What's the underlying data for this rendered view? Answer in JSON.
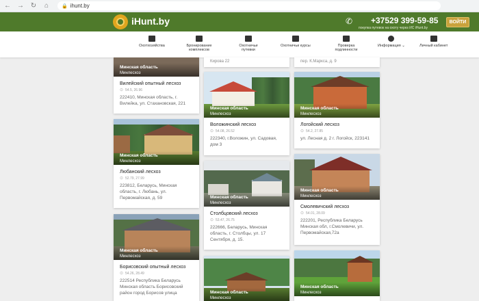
{
  "browser": {
    "url": "ihunt.by"
  },
  "header": {
    "brand": "iHunt.by",
    "phone": "+37529 399-59-85",
    "phone_note": "покупка путевок на охоту через ИС iHunt.by",
    "login": "ВОЙТИ"
  },
  "nav": {
    "items": [
      {
        "label": "Охотхозяйства"
      },
      {
        "label": "Бронирование комплексов"
      },
      {
        "label": "Охотничьи путевки"
      },
      {
        "label": "Охотничьи курсы"
      },
      {
        "label": "Проверка подлинности"
      },
      {
        "label": "Информация ⌄"
      },
      {
        "label": "Личный кабинет"
      }
    ]
  },
  "partial": {
    "col2_address": "Кирова 22",
    "col3_address": "пер. К.Маркса, д. 9"
  },
  "cards": [
    {
      "region": "Минская область",
      "org": "Минлесхоз",
      "title": "Вилейский опытный лесхоз",
      "coords": "54.5, 26.96",
      "address": "222410, Минская область, г. Вилейка, ул. Стахановская, 221"
    },
    {
      "region": "Минская область",
      "org": "Минлесхоз",
      "title": "Любанский лесхоз",
      "coords": "52.79, 27.99",
      "address": "223812, Беларусь, Минская область, г. Любань, ул. Первомайская, д. 59"
    },
    {
      "region": "Минская область",
      "org": "Минлесхоз",
      "title": "Борисовский опытный лесхоз",
      "coords": "54.26, 28.49",
      "address": "222514 Республика Беларусь Минская область Борисовский район город Борисов улица"
    },
    {
      "region": "Минская область",
      "org": "Минлесхоз",
      "title": "Воложинский лесхоз",
      "coords": "54.08, 26.52",
      "address": "222340, г.Воложин, ул. Садовая, дом 3"
    },
    {
      "region": "Минская область",
      "org": "Минлесхоз",
      "title": "Столбцовский лесхоз",
      "coords": "53.47, 26.75",
      "address": "222666, Беларусь, Минская область, г. Столбцы, ул. 17 Сентября, д. 15."
    },
    {
      "region": "Минская область",
      "org": "Минлесхоз",
      "title": "",
      "coords": "",
      "address": ""
    },
    {
      "region": "Минская область",
      "org": "Минлесхоз",
      "title": "Логойский лесхоз",
      "coords": "54.2, 27.85",
      "address": "ул. Лесная д. 2 г. Логойск, 223141"
    },
    {
      "region": "Минская область",
      "org": "Минлесхоз",
      "title": "Смолевичский лесхоз",
      "coords": "54.01, 28.09",
      "address": "222201, Республика Беларусь Минская обл, г.Смолевичи, ул. Первомайская,72а"
    },
    {
      "region": "Минская область",
      "org": "Минлесхоз",
      "title": "",
      "coords": "",
      "address": ""
    }
  ]
}
